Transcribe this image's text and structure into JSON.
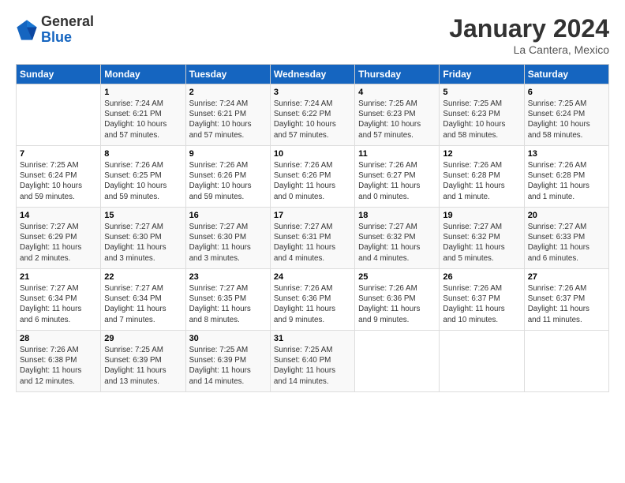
{
  "header": {
    "logo_general": "General",
    "logo_blue": "Blue",
    "month_title": "January 2024",
    "location": "La Cantera, Mexico"
  },
  "columns": [
    "Sunday",
    "Monday",
    "Tuesday",
    "Wednesday",
    "Thursday",
    "Friday",
    "Saturday"
  ],
  "weeks": [
    [
      {
        "day": "",
        "info": ""
      },
      {
        "day": "1",
        "info": "Sunrise: 7:24 AM\nSunset: 6:21 PM\nDaylight: 10 hours\nand 57 minutes."
      },
      {
        "day": "2",
        "info": "Sunrise: 7:24 AM\nSunset: 6:21 PM\nDaylight: 10 hours\nand 57 minutes."
      },
      {
        "day": "3",
        "info": "Sunrise: 7:24 AM\nSunset: 6:22 PM\nDaylight: 10 hours\nand 57 minutes."
      },
      {
        "day": "4",
        "info": "Sunrise: 7:25 AM\nSunset: 6:23 PM\nDaylight: 10 hours\nand 57 minutes."
      },
      {
        "day": "5",
        "info": "Sunrise: 7:25 AM\nSunset: 6:23 PM\nDaylight: 10 hours\nand 58 minutes."
      },
      {
        "day": "6",
        "info": "Sunrise: 7:25 AM\nSunset: 6:24 PM\nDaylight: 10 hours\nand 58 minutes."
      }
    ],
    [
      {
        "day": "7",
        "info": "Sunrise: 7:25 AM\nSunset: 6:24 PM\nDaylight: 10 hours\nand 59 minutes."
      },
      {
        "day": "8",
        "info": "Sunrise: 7:26 AM\nSunset: 6:25 PM\nDaylight: 10 hours\nand 59 minutes."
      },
      {
        "day": "9",
        "info": "Sunrise: 7:26 AM\nSunset: 6:26 PM\nDaylight: 10 hours\nand 59 minutes."
      },
      {
        "day": "10",
        "info": "Sunrise: 7:26 AM\nSunset: 6:26 PM\nDaylight: 11 hours\nand 0 minutes."
      },
      {
        "day": "11",
        "info": "Sunrise: 7:26 AM\nSunset: 6:27 PM\nDaylight: 11 hours\nand 0 minutes."
      },
      {
        "day": "12",
        "info": "Sunrise: 7:26 AM\nSunset: 6:28 PM\nDaylight: 11 hours\nand 1 minute."
      },
      {
        "day": "13",
        "info": "Sunrise: 7:26 AM\nSunset: 6:28 PM\nDaylight: 11 hours\nand 1 minute."
      }
    ],
    [
      {
        "day": "14",
        "info": "Sunrise: 7:27 AM\nSunset: 6:29 PM\nDaylight: 11 hours\nand 2 minutes."
      },
      {
        "day": "15",
        "info": "Sunrise: 7:27 AM\nSunset: 6:30 PM\nDaylight: 11 hours\nand 3 minutes."
      },
      {
        "day": "16",
        "info": "Sunrise: 7:27 AM\nSunset: 6:30 PM\nDaylight: 11 hours\nand 3 minutes."
      },
      {
        "day": "17",
        "info": "Sunrise: 7:27 AM\nSunset: 6:31 PM\nDaylight: 11 hours\nand 4 minutes."
      },
      {
        "day": "18",
        "info": "Sunrise: 7:27 AM\nSunset: 6:32 PM\nDaylight: 11 hours\nand 4 minutes."
      },
      {
        "day": "19",
        "info": "Sunrise: 7:27 AM\nSunset: 6:32 PM\nDaylight: 11 hours\nand 5 minutes."
      },
      {
        "day": "20",
        "info": "Sunrise: 7:27 AM\nSunset: 6:33 PM\nDaylight: 11 hours\nand 6 minutes."
      }
    ],
    [
      {
        "day": "21",
        "info": "Sunrise: 7:27 AM\nSunset: 6:34 PM\nDaylight: 11 hours\nand 6 minutes."
      },
      {
        "day": "22",
        "info": "Sunrise: 7:27 AM\nSunset: 6:34 PM\nDaylight: 11 hours\nand 7 minutes."
      },
      {
        "day": "23",
        "info": "Sunrise: 7:27 AM\nSunset: 6:35 PM\nDaylight: 11 hours\nand 8 minutes."
      },
      {
        "day": "24",
        "info": "Sunrise: 7:26 AM\nSunset: 6:36 PM\nDaylight: 11 hours\nand 9 minutes."
      },
      {
        "day": "25",
        "info": "Sunrise: 7:26 AM\nSunset: 6:36 PM\nDaylight: 11 hours\nand 9 minutes."
      },
      {
        "day": "26",
        "info": "Sunrise: 7:26 AM\nSunset: 6:37 PM\nDaylight: 11 hours\nand 10 minutes."
      },
      {
        "day": "27",
        "info": "Sunrise: 7:26 AM\nSunset: 6:37 PM\nDaylight: 11 hours\nand 11 minutes."
      }
    ],
    [
      {
        "day": "28",
        "info": "Sunrise: 7:26 AM\nSunset: 6:38 PM\nDaylight: 11 hours\nand 12 minutes."
      },
      {
        "day": "29",
        "info": "Sunrise: 7:25 AM\nSunset: 6:39 PM\nDaylight: 11 hours\nand 13 minutes."
      },
      {
        "day": "30",
        "info": "Sunrise: 7:25 AM\nSunset: 6:39 PM\nDaylight: 11 hours\nand 14 minutes."
      },
      {
        "day": "31",
        "info": "Sunrise: 7:25 AM\nSunset: 6:40 PM\nDaylight: 11 hours\nand 14 minutes."
      },
      {
        "day": "",
        "info": ""
      },
      {
        "day": "",
        "info": ""
      },
      {
        "day": "",
        "info": ""
      }
    ]
  ]
}
